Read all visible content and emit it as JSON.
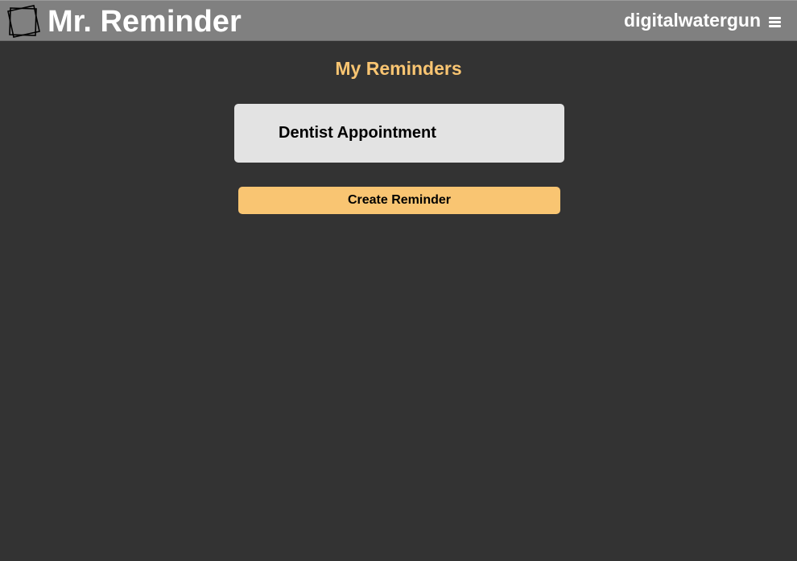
{
  "header": {
    "brand": "Mr. Reminder",
    "logo_icon": "sticky-note-icon",
    "username": "digitalwatergun",
    "menu_icon": "hamburger-menu-icon"
  },
  "main": {
    "title": "My Reminders",
    "reminders": [
      {
        "title": "Dentist Appointment"
      }
    ],
    "create_button_label": "Create Reminder"
  },
  "colors": {
    "header_bg": "#808080",
    "page_bg": "#333333",
    "accent": "#f9c572",
    "card_bg": "#e3e3e3"
  }
}
